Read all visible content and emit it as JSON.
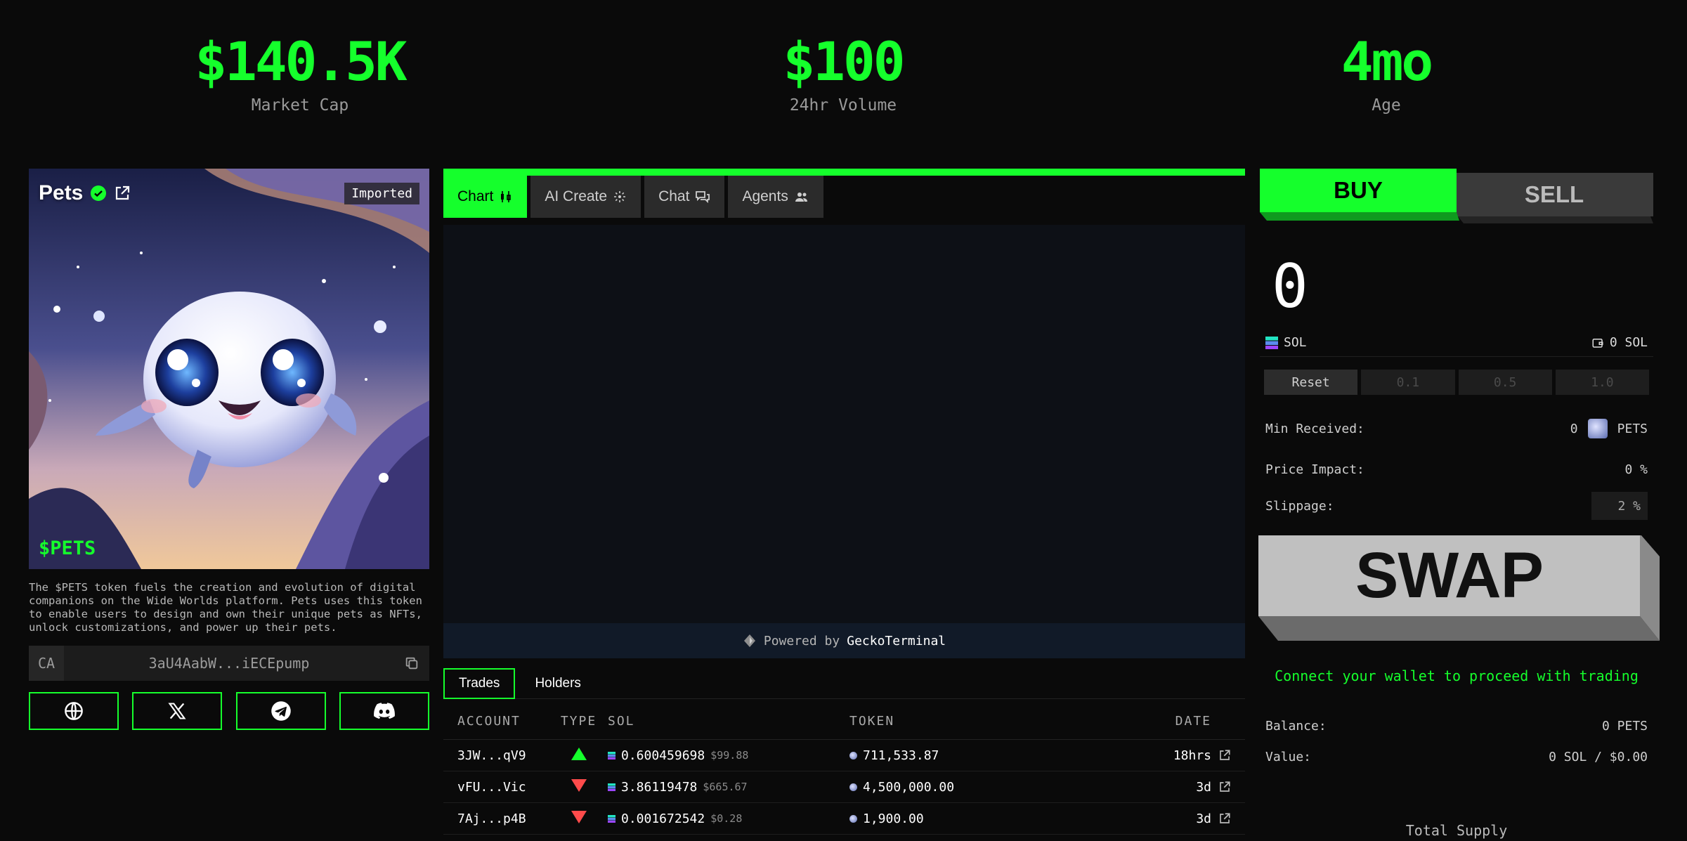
{
  "stats": [
    {
      "value": "$140.5K",
      "label": "Market Cap"
    },
    {
      "value": "$100",
      "label": "24hr Volume"
    },
    {
      "value": "4mo",
      "label": "Age"
    }
  ],
  "token": {
    "name": "Pets",
    "badge": "Imported",
    "ticker": "$PETS",
    "description": "The $PETS token fuels the creation and evolution of digital companions on the Wide Worlds platform. Pets uses this token to enable users to design and own their unique pets as NFTs, unlock customizations, and power up their pets.",
    "ca_label": "CA",
    "ca_address": "3aU4AabW...iECEpump"
  },
  "socials": [
    "globe-icon",
    "x-icon",
    "telegram-icon",
    "discord-icon"
  ],
  "tabs": [
    {
      "label": "Chart",
      "icon": "candlestick-icon",
      "active": true
    },
    {
      "label": "AI Create",
      "icon": "sparkle-icon",
      "active": false
    },
    {
      "label": "Chat",
      "icon": "chat-icon",
      "active": false
    },
    {
      "label": "Agents",
      "icon": "people-icon",
      "active": false
    }
  ],
  "powered": {
    "prefix": "Powered by",
    "brand": "GeckoTerminal"
  },
  "trade_tabs": {
    "trades": "Trades",
    "holders": "Holders"
  },
  "table": {
    "headers": {
      "account": "ACCOUNT",
      "type": "TYPE",
      "sol": "SOL",
      "token": "TOKEN",
      "date": "DATE"
    },
    "rows": [
      {
        "account": "3JW...qV9",
        "type": "buy",
        "sol": "0.600459698",
        "usd": "$99.88",
        "token": "711,533.87",
        "date": "18hrs"
      },
      {
        "account": "vFU...Vic",
        "type": "sell",
        "sol": "3.86119478",
        "usd": "$665.67",
        "token": "4,500,000.00",
        "date": "3d"
      },
      {
        "account": "7Aj...p4B",
        "type": "sell",
        "sol": "0.001672542",
        "usd": "$0.28",
        "token": "1,900.00",
        "date": "3d"
      }
    ]
  },
  "trade": {
    "buy": "BUY",
    "sell": "SELL",
    "amount": "0",
    "currency": "SOL",
    "wallet_balance": "0 SOL",
    "presets": [
      "Reset",
      "0.1",
      "0.5",
      "1.0"
    ],
    "min_received_label": "Min Received:",
    "min_received_value": "0",
    "min_received_token": "PETS",
    "price_impact_label": "Price Impact:",
    "price_impact_value": "0 %",
    "slippage_label": "Slippage:",
    "slippage_value": "2 %",
    "swap": "SWAP",
    "connect_msg": "Connect your wallet to proceed with trading",
    "balance_label": "Balance:",
    "balance_value": "0 PETS",
    "value_label": "Value:",
    "value_value": "0 SOL / $0.00",
    "total_supply": "Total Supply"
  },
  "colors": {
    "accent": "#15ff2c",
    "buy": "#15ff2c",
    "sell": "#ff4b4b",
    "bg": "#0a0a0a"
  }
}
